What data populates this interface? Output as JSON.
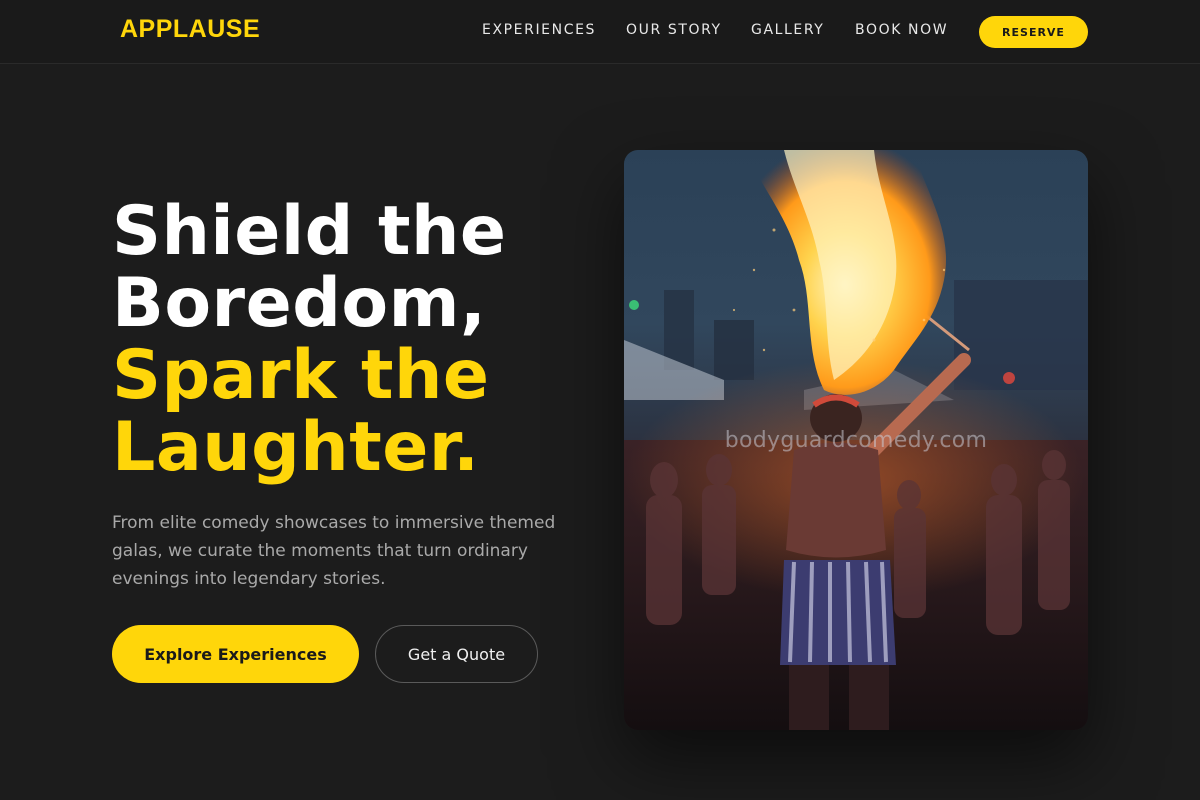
{
  "nav": {
    "logo": "APPLAUSE",
    "links": [
      "EXPERIENCES",
      "OUR STORY",
      "GALLERY",
      "BOOK NOW"
    ],
    "reserve_label": "RESERVE"
  },
  "hero": {
    "title_white": [
      "Shield the",
      "Boredom,"
    ],
    "title_yellow": [
      "Spark the",
      "Laughter."
    ],
    "description": "From elite comedy showcases to immersive themed galas, we curate the moments that turn ordinary evenings into legendary stories.",
    "primary_button": "Explore Experiences",
    "secondary_button": "Get a Quote"
  },
  "image": {
    "watermark": "bodyguardcomedy.com"
  },
  "colors": {
    "accent": "#ffd60a",
    "background": "#1c1c1c",
    "muted_text": "#a9a9a9"
  }
}
